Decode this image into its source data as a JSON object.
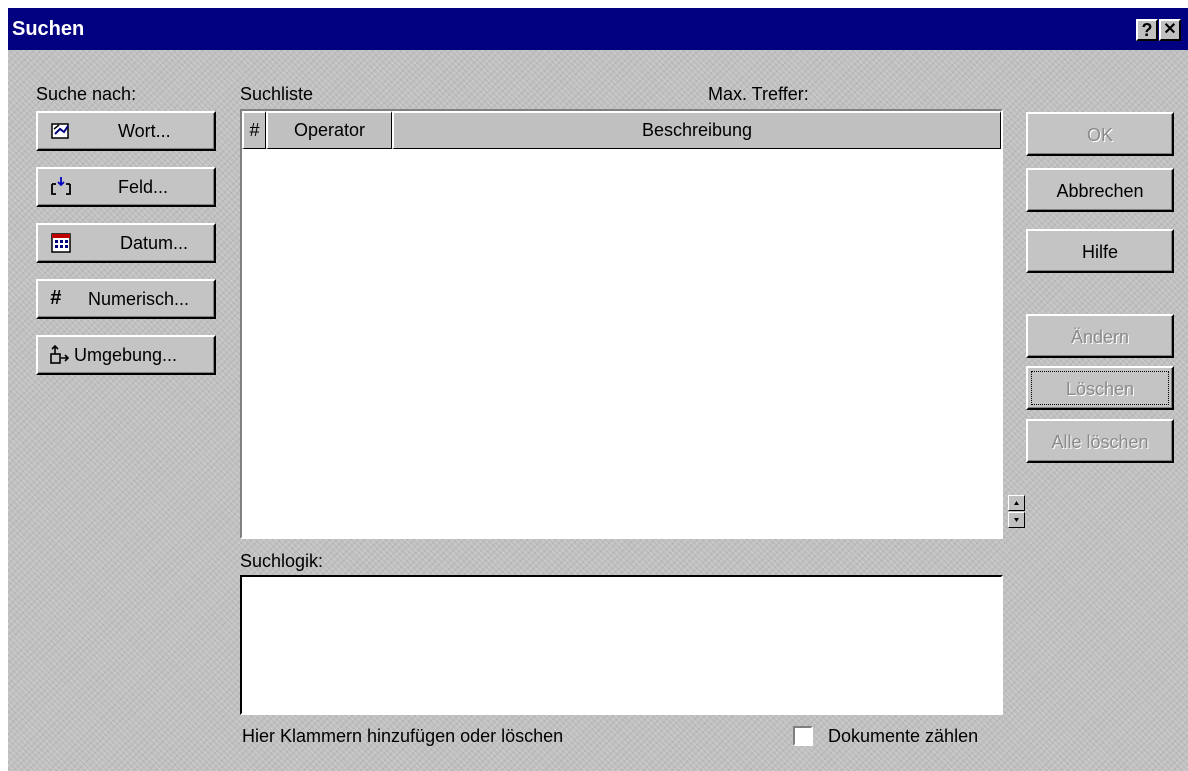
{
  "window": {
    "title": "Suchen",
    "help_button": "?",
    "close_button": "✕"
  },
  "left_panel": {
    "label": "Suche nach:",
    "buttons": [
      {
        "label": "Wort...",
        "icon": "word-search-icon"
      },
      {
        "label": "Feld...",
        "icon": "field-icon"
      },
      {
        "label": "Datum...",
        "icon": "calendar-icon"
      },
      {
        "label": "Numerisch...",
        "icon": "hash-icon",
        "glyph": "#"
      },
      {
        "label": "Umgebung...",
        "icon": "proximity-icon"
      }
    ]
  },
  "search_list": {
    "label": "Suchliste",
    "max_hits_label": "Max. Treffer:",
    "columns": [
      "#",
      "Operator",
      "Beschreibung"
    ],
    "rows": []
  },
  "search_logic": {
    "label": "Suchlogik:",
    "value": "",
    "hint": "Hier Klammern hinzufügen oder löschen"
  },
  "count_documents": {
    "label": "Dokumente zählen",
    "checked": false
  },
  "right_buttons": {
    "ok": "OK",
    "cancel": "Abbrechen",
    "help": "Hilfe",
    "change": "Ändern",
    "delete": "Löschen",
    "delete_all": "Alle löschen"
  }
}
